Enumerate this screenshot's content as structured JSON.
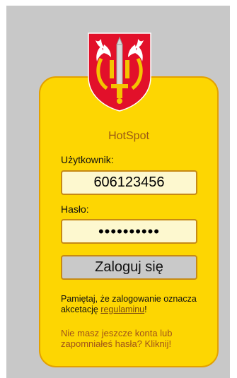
{
  "header": {
    "title": "HotSpot"
  },
  "form": {
    "username_label": "Użytkownik:",
    "username_value": "606123456",
    "password_label": "Hasło:",
    "password_value": "••••••••••",
    "login_button": "Zaloguj się"
  },
  "notice": {
    "text": "Pamiętaj, że zalogowanie oznacza akcetację",
    "link": "regulaminu",
    "suffix": "!"
  },
  "forgot": {
    "text": "Nie masz jeszcze konta lub zapomniałeś hasła? Kliknij!"
  },
  "colors": {
    "card_background": "#fdd602",
    "card_border": "#e3a100",
    "page_background": "#c8c8c8",
    "title": "#9a5a14",
    "field_background": "#fdf8cf",
    "button_background": "#c9c9c9",
    "forgot_text": "#a0541a"
  },
  "icons": {
    "crest": "coat-of-arms-icon"
  }
}
